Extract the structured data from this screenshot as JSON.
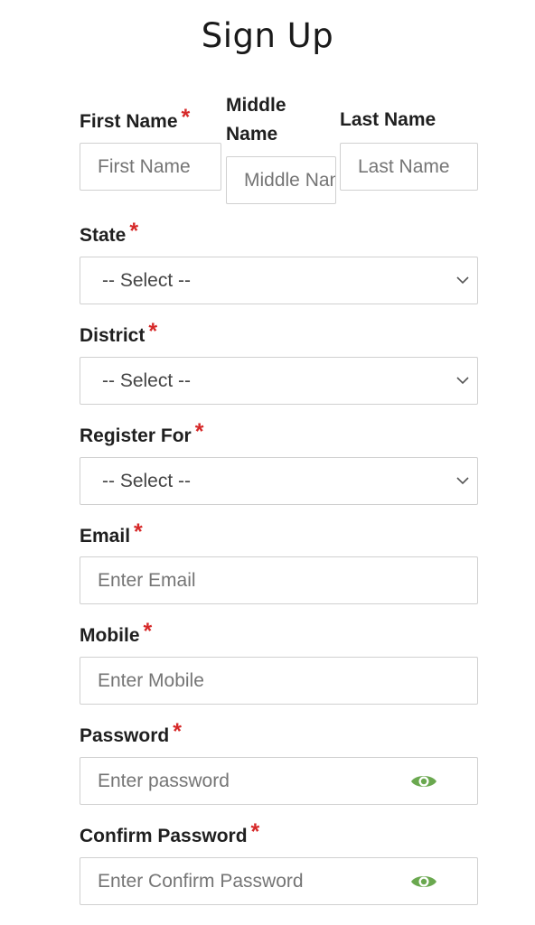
{
  "page": {
    "title": "Sign Up"
  },
  "first_name": {
    "label": "First Name",
    "placeholder": "First Name",
    "required_mark": "*"
  },
  "middle_name": {
    "label_line1": "Middle",
    "label_line2": "Name",
    "placeholder": "Middle Name"
  },
  "last_name": {
    "label": "Last Name",
    "placeholder": "Last Name"
  },
  "state": {
    "label": "State",
    "selected": "-- Select --",
    "required_mark": "*"
  },
  "district": {
    "label": "District",
    "selected": "-- Select --",
    "required_mark": "*"
  },
  "register_for": {
    "label": "Register For",
    "selected": "-- Select --",
    "required_mark": "*"
  },
  "email": {
    "label": "Email",
    "placeholder": "Enter Email",
    "required_mark": "*"
  },
  "mobile": {
    "label": "Mobile",
    "placeholder": "Enter Mobile",
    "required_mark": "*"
  },
  "password": {
    "label": "Password",
    "placeholder": "Enter password",
    "required_mark": "*"
  },
  "confirm_password": {
    "label": "Confirm Password",
    "placeholder": "Enter Confirm Password",
    "required_mark": "*"
  },
  "colors": {
    "required": "#d62828",
    "eye_icon": "#6aa84f",
    "border": "#d0d0d0"
  },
  "icons": {
    "select_arrow": "chevron-down-icon",
    "password_toggle": "eye-icon"
  }
}
